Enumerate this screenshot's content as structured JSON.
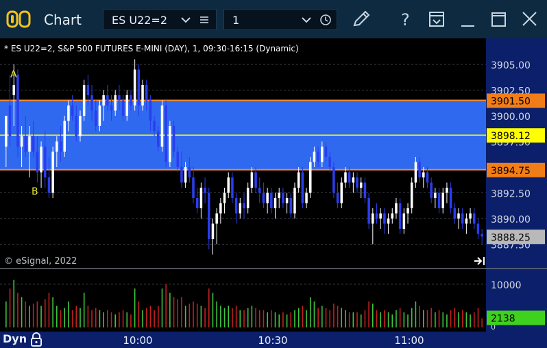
{
  "window": {
    "title": "Chart",
    "symbol": "ES U22=2",
    "interval": "1"
  },
  "chart_info": "* ES U22=2, S&P 500 FUTURES E-MINI (DAY), 1, 09:30-16:15 (Dynamic)",
  "copyright": "© eSignal, 2022",
  "status": {
    "label": "Dyn"
  },
  "colors": {
    "up": "#ffffff",
    "down": "#2a3df0",
    "zone": "#2f69f0",
    "zone_line": "#ff8a1e",
    "mid_line": "#ffff00",
    "volume_up": "#3fc63f",
    "volume_down": "#c52020"
  },
  "chart_data": {
    "type": "candlestick",
    "y_price_ticks": [
      "3905.00",
      "3902.50",
      "3900.00",
      "3897.50",
      "3892.50",
      "3890.00",
      "3887.50"
    ],
    "x_time_ticks": [
      "10:00",
      "10:30",
      "11:00"
    ],
    "ylim": [
      3886.5,
      3906.2
    ],
    "zone": {
      "top": 3901.5,
      "bottom": 3894.75,
      "top_label": "3901.50",
      "bottom_label": "3894.75"
    },
    "mid_line": {
      "value": 3898.12,
      "label": "3898.12"
    },
    "last_price": {
      "value": 3888.25,
      "label": "3888.25"
    },
    "markers": [
      {
        "label": "A",
        "price": 3904.0
      },
      {
        "label": "B",
        "price": 3892.6
      }
    ],
    "volume": {
      "tick": "10000",
      "zero": "0",
      "last_label": "2138",
      "max": 13000
    },
    "candles": [
      [
        3897.0,
        3900.0,
        3895.0,
        3900.0,
        6000
      ],
      [
        3901.0,
        3904.0,
        3897.0,
        3898.0,
        9000
      ],
      [
        3902.0,
        3905.0,
        3899.0,
        3903.0,
        11000
      ],
      [
        3904.0,
        3904.5,
        3896.0,
        3897.0,
        8000
      ],
      [
        3897.0,
        3899.0,
        3895.0,
        3898.0,
        7000
      ],
      [
        3898.0,
        3900.0,
        3896.0,
        3896.5,
        6000
      ],
      [
        3896.5,
        3899.0,
        3894.0,
        3898.0,
        5000
      ],
      [
        3898.0,
        3899.5,
        3896.0,
        3896.5,
        5500
      ],
      [
        3896.5,
        3898.0,
        3893.5,
        3894.5,
        6000
      ],
      [
        3894.5,
        3897.5,
        3893.0,
        3897.0,
        5000
      ],
      [
        3897.0,
        3898.5,
        3893.0,
        3894.0,
        6500
      ],
      [
        3894.0,
        3896.0,
        3892.0,
        3892.5,
        8000
      ],
      [
        3892.5,
        3897.0,
        3892.0,
        3896.5,
        7000
      ],
      [
        3896.5,
        3898.0,
        3895.0,
        3897.5,
        5000
      ],
      [
        3897.5,
        3899.0,
        3895.5,
        3896.5,
        4000
      ],
      [
        3896.5,
        3900.0,
        3896.0,
        3899.5,
        4500
      ],
      [
        3899.5,
        3901.5,
        3898.5,
        3901.0,
        6000
      ],
      [
        3901.0,
        3902.0,
        3899.5,
        3900.0,
        4000
      ],
      [
        3900.0,
        3901.0,
        3897.5,
        3898.0,
        5000
      ],
      [
        3898.0,
        3900.5,
        3897.5,
        3900.0,
        4500
      ],
      [
        3900.0,
        3903.5,
        3899.5,
        3903.0,
        8000
      ],
      [
        3903.0,
        3904.0,
        3901.0,
        3902.0,
        5000
      ],
      [
        3902.0,
        3903.0,
        3899.5,
        3900.5,
        4000
      ],
      [
        3900.5,
        3901.5,
        3898.5,
        3899.0,
        4500
      ],
      [
        3899.0,
        3901.5,
        3898.5,
        3901.0,
        4000
      ],
      [
        3901.0,
        3902.5,
        3899.5,
        3902.0,
        3500
      ],
      [
        3902.0,
        3903.0,
        3900.5,
        3901.0,
        4000
      ],
      [
        3901.0,
        3902.0,
        3899.5,
        3900.5,
        3500
      ],
      [
        3900.5,
        3902.5,
        3900.0,
        3902.0,
        3000
      ],
      [
        3902.0,
        3903.0,
        3900.5,
        3901.5,
        3500
      ],
      [
        3901.5,
        3902.0,
        3899.5,
        3900.0,
        4000
      ],
      [
        3900.0,
        3902.5,
        3899.5,
        3902.0,
        3500
      ],
      [
        3902.0,
        3902.5,
        3900.5,
        3901.0,
        3000
      ],
      [
        3901.0,
        3905.5,
        3900.5,
        3904.5,
        9000
      ],
      [
        3904.5,
        3905.0,
        3900.0,
        3901.0,
        6000
      ],
      [
        3901.0,
        3903.5,
        3900.5,
        3903.0,
        4000
      ],
      [
        3903.0,
        3903.5,
        3900.5,
        3901.5,
        4500
      ],
      [
        3901.5,
        3902.0,
        3898.5,
        3899.5,
        5000
      ],
      [
        3899.5,
        3900.0,
        3898.0,
        3898.5,
        4000
      ],
      [
        3898.5,
        3899.0,
        3896.5,
        3897.0,
        5000
      ],
      [
        3897.0,
        3901.5,
        3896.5,
        3901.0,
        9000
      ],
      [
        3901.0,
        3901.5,
        3895.0,
        3895.5,
        10000
      ],
      [
        3895.5,
        3899.5,
        3895.0,
        3899.0,
        8000
      ],
      [
        3899.0,
        3899.5,
        3896.0,
        3896.5,
        7000
      ],
      [
        3896.5,
        3897.0,
        3894.5,
        3895.0,
        6500
      ],
      [
        3895.0,
        3896.5,
        3893.0,
        3893.5,
        7000
      ],
      [
        3893.5,
        3895.5,
        3893.0,
        3895.0,
        5000
      ],
      [
        3895.0,
        3896.0,
        3893.5,
        3894.0,
        5500
      ],
      [
        3894.0,
        3895.0,
        3891.5,
        3892.0,
        6000
      ],
      [
        3892.0,
        3893.0,
        3890.5,
        3891.0,
        5500
      ],
      [
        3891.0,
        3893.5,
        3890.0,
        3893.0,
        5000
      ],
      [
        3893.0,
        3894.0,
        3891.5,
        3892.5,
        4500
      ],
      [
        3892.5,
        3893.0,
        3887.0,
        3888.0,
        9000
      ],
      [
        3888.0,
        3890.0,
        3886.5,
        3889.5,
        8000
      ],
      [
        3889.5,
        3891.0,
        3887.5,
        3890.5,
        6000
      ],
      [
        3890.5,
        3892.0,
        3889.5,
        3891.5,
        5000
      ],
      [
        3891.5,
        3893.0,
        3890.5,
        3892.5,
        4500
      ],
      [
        3892.5,
        3894.5,
        3892.0,
        3894.0,
        5000
      ],
      [
        3894.0,
        3894.5,
        3891.5,
        3892.0,
        4500
      ],
      [
        3892.0,
        3892.5,
        3889.5,
        3890.5,
        5000
      ],
      [
        3890.5,
        3892.0,
        3890.0,
        3891.5,
        4000
      ],
      [
        3891.5,
        3892.5,
        3890.0,
        3891.0,
        4000
      ],
      [
        3891.0,
        3893.5,
        3890.5,
        3893.0,
        4500
      ],
      [
        3893.0,
        3895.0,
        3892.5,
        3894.5,
        5000
      ],
      [
        3894.5,
        3895.0,
        3892.5,
        3893.0,
        4500
      ],
      [
        3893.0,
        3894.0,
        3891.5,
        3892.5,
        4000
      ],
      [
        3892.5,
        3893.5,
        3891.0,
        3891.5,
        4000
      ],
      [
        3891.5,
        3893.0,
        3890.5,
        3892.5,
        3500
      ],
      [
        3892.5,
        3893.0,
        3890.5,
        3891.0,
        4000
      ],
      [
        3891.0,
        3892.5,
        3890.0,
        3892.0,
        3500
      ],
      [
        3892.0,
        3893.0,
        3891.0,
        3892.5,
        3000
      ],
      [
        3892.5,
        3893.0,
        3891.0,
        3891.5,
        3500
      ],
      [
        3891.5,
        3892.5,
        3890.5,
        3892.0,
        3000
      ],
      [
        3892.0,
        3892.5,
        3890.0,
        3890.5,
        3500
      ],
      [
        3890.5,
        3893.5,
        3890.0,
        3893.0,
        4000
      ],
      [
        3893.0,
        3895.0,
        3892.5,
        3894.5,
        4500
      ],
      [
        3894.5,
        3895.0,
        3891.0,
        3891.5,
        5000
      ],
      [
        3891.5,
        3893.0,
        3891.0,
        3892.5,
        4000
      ],
      [
        3892.5,
        3896.0,
        3892.0,
        3895.5,
        7000
      ],
      [
        3895.5,
        3897.0,
        3895.0,
        3896.5,
        6000
      ],
      [
        3896.5,
        3897.0,
        3895.0,
        3895.5,
        4500
      ],
      [
        3895.5,
        3897.5,
        3895.0,
        3897.0,
        5000
      ],
      [
        3897.0,
        3897.5,
        3895.5,
        3896.0,
        4500
      ],
      [
        3896.0,
        3896.5,
        3894.5,
        3895.0,
        4000
      ],
      [
        3895.0,
        3895.5,
        3892.0,
        3892.5,
        5500
      ],
      [
        3892.5,
        3893.5,
        3891.0,
        3891.5,
        5000
      ],
      [
        3891.5,
        3894.0,
        3891.0,
        3893.5,
        4500
      ],
      [
        3893.5,
        3895.0,
        3893.0,
        3894.5,
        4000
      ],
      [
        3894.5,
        3895.0,
        3893.0,
        3893.5,
        3500
      ],
      [
        3893.5,
        3894.5,
        3892.5,
        3894.0,
        3500
      ],
      [
        3894.0,
        3894.5,
        3892.5,
        3893.0,
        3500
      ],
      [
        3893.0,
        3894.0,
        3892.0,
        3893.5,
        3000
      ],
      [
        3893.5,
        3894.0,
        3891.5,
        3892.0,
        4000
      ],
      [
        3892.0,
        3892.5,
        3889.0,
        3889.5,
        6000
      ],
      [
        3889.5,
        3891.0,
        3887.5,
        3890.5,
        5500
      ],
      [
        3890.5,
        3891.5,
        3889.5,
        3890.0,
        4000
      ],
      [
        3890.0,
        3891.0,
        3889.0,
        3890.5,
        3500
      ],
      [
        3890.5,
        3891.0,
        3888.5,
        3889.5,
        4000
      ],
      [
        3889.5,
        3890.5,
        3888.5,
        3890.0,
        3500
      ],
      [
        3890.0,
        3891.0,
        3889.5,
        3890.5,
        3000
      ],
      [
        3890.5,
        3892.0,
        3890.0,
        3891.5,
        4000
      ],
      [
        3891.5,
        3892.0,
        3888.5,
        3889.0,
        4500
      ],
      [
        3889.0,
        3891.0,
        3888.5,
        3890.5,
        3500
      ],
      [
        3890.5,
        3891.5,
        3889.5,
        3891.0,
        3000
      ],
      [
        3891.0,
        3894.0,
        3890.5,
        3893.5,
        4500
      ],
      [
        3893.5,
        3896.0,
        3893.0,
        3895.5,
        6000
      ],
      [
        3895.5,
        3896.0,
        3893.5,
        3894.0,
        5000
      ],
      [
        3894.0,
        3895.0,
        3893.0,
        3894.5,
        4000
      ],
      [
        3894.5,
        3895.0,
        3893.0,
        3893.5,
        4000
      ],
      [
        3893.5,
        3894.0,
        3891.5,
        3892.0,
        4500
      ],
      [
        3892.0,
        3893.0,
        3891.0,
        3892.5,
        3500
      ],
      [
        3892.5,
        3893.0,
        3890.5,
        3891.0,
        4000
      ],
      [
        3891.0,
        3893.0,
        3890.5,
        3892.5,
        3500
      ],
      [
        3892.5,
        3893.5,
        3891.5,
        3893.0,
        3000
      ],
      [
        3893.0,
        3893.5,
        3890.5,
        3891.0,
        4000
      ],
      [
        3891.0,
        3891.5,
        3889.5,
        3890.0,
        4500
      ],
      [
        3890.0,
        3891.0,
        3889.0,
        3890.5,
        3500
      ],
      [
        3890.5,
        3891.0,
        3889.0,
        3889.5,
        4000
      ],
      [
        3889.5,
        3890.5,
        3888.5,
        3890.0,
        3500
      ],
      [
        3890.0,
        3891.0,
        3889.5,
        3890.5,
        3000
      ],
      [
        3890.5,
        3891.0,
        3889.0,
        3889.5,
        3500
      ],
      [
        3889.5,
        3890.0,
        3888.0,
        3888.5,
        4500
      ],
      [
        3888.5,
        3889.0,
        3887.5,
        3888.25,
        2138
      ]
    ]
  }
}
